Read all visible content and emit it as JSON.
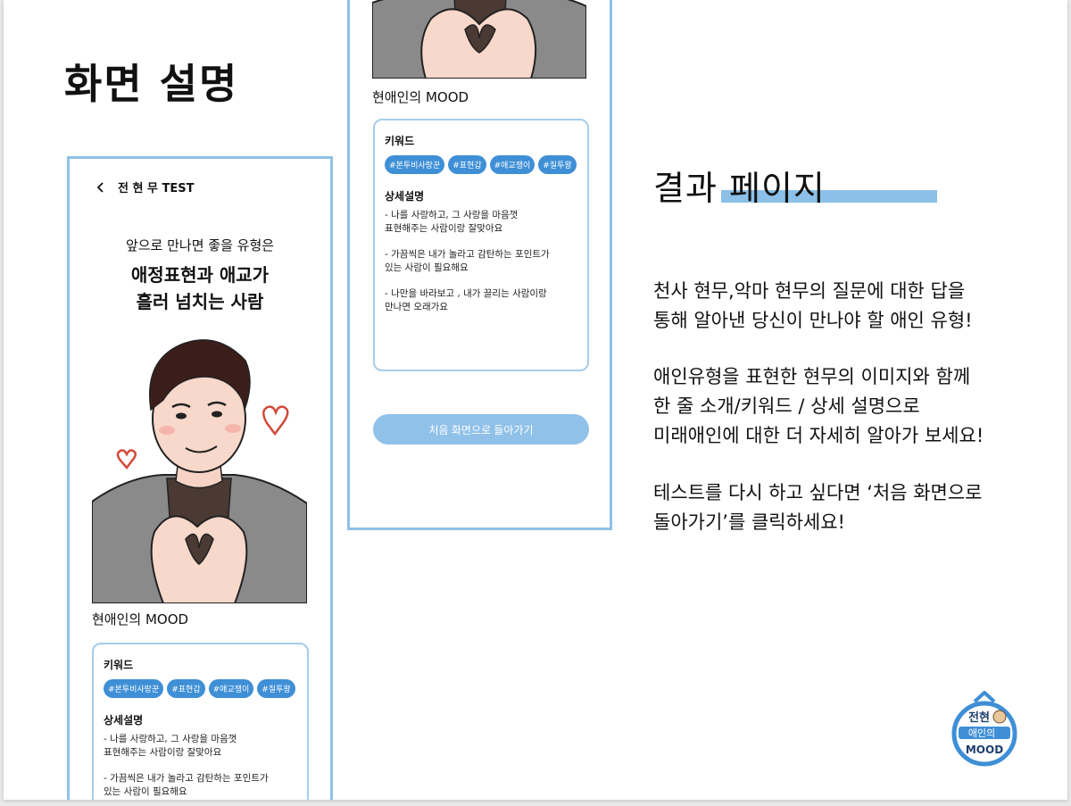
{
  "page": {
    "title": "화면 설명"
  },
  "phone1": {
    "header_title": "전 현 무 TEST",
    "result_sub": "앞으로 만나면 좋을 유형은",
    "result_main_1": "애정표현과 애교가",
    "result_main_2": "흘러 넘치는 사람",
    "mood_title": "현애인의 MOOD",
    "keyword_label": "키워드",
    "tags": [
      "#본투비사랑꾼",
      "#표현갑",
      "#애교쟁이",
      "#질투왕"
    ],
    "desc_label": "상세설명",
    "desc_1": "- 나를 사랑하고, 그 사랑을 마음껏\n표현해주는 사람이랑 잘맞아요",
    "desc_2": "- 가끔씩은 내가 놀라고 감탄하는 포인트가\n있는 사람이 필요해요"
  },
  "phone2": {
    "mood_title": "현애인의 MOOD",
    "keyword_label": "키워드",
    "tags": [
      "#본투비사랑꾼",
      "#표현갑",
      "#애교쟁이",
      "#질투왕"
    ],
    "desc_label": "상세설명",
    "desc_1": "- 나를 사랑하고, 그 사랑을 마음껏\n표현해주는 사람이랑 잘맞아요",
    "desc_2": "- 가끔씩은 내가 놀라고 감탄하는 포인트가\n있는 사람이 필요해요",
    "desc_3": "- 나만을 바라보고 , 내가 끌리는 사람이랑\n만나면 오래가요",
    "restart_label": "처음 화면으로 들아가기"
  },
  "explain": {
    "section_title": "결과 페이지",
    "p1": "천사 현무,악마 현무의 질문에 대한 답을\n통해 알아낸 당신이 만나야 할 애인 유형!",
    "p2": "애인유형을 표현한 현무의 이미지와 함께\n한 줄 소개/키워드 / 상세 설명으로\n미래애인에 대한 더 자세히 알아가 보세요!",
    "p3": "테스트를 다시 하고 싶다면 ‘처음 화면으로\n돌아가기’를 클릭하세요!"
  },
  "logo": {
    "line1": "전현",
    "line2": "애인의",
    "line3": "MOOD"
  },
  "colors": {
    "accent": "#3e8fd6",
    "frame": "#8fc1e6",
    "button": "#90c1e9",
    "underline": "#8cc0e8"
  }
}
